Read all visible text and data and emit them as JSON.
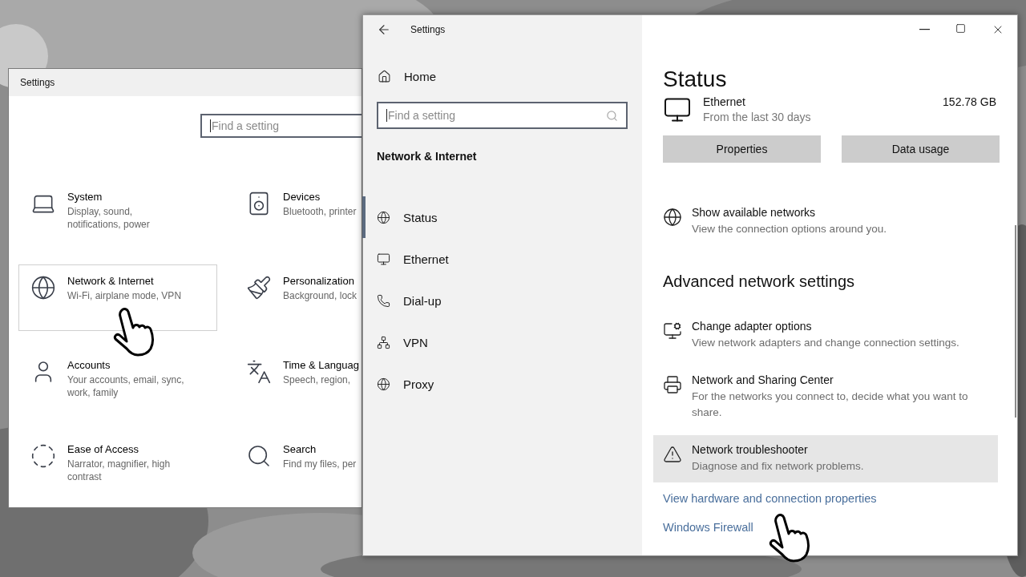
{
  "back_window": {
    "title": "Settings",
    "search": {
      "placeholder": "Find a setting"
    },
    "categories": [
      {
        "name": "System",
        "description": "Display, sound, notifications, power",
        "selected": false
      },
      {
        "name": "Devices",
        "description": "Bluetooth, printer",
        "selected": false
      },
      {
        "name": "Network & Internet",
        "description": "Wi-Fi, airplane mode, VPN",
        "selected": true
      },
      {
        "name": "Personalization",
        "description": "Background, lock",
        "selected": false
      },
      {
        "name": "Accounts",
        "description": "Your accounts, email, sync, work, family",
        "selected": false
      },
      {
        "name": "Time & Languag",
        "description": "Speech, region,",
        "selected": false
      },
      {
        "name": "Ease of Access",
        "description": "Narrator, magnifier, high contrast",
        "selected": false
      },
      {
        "name": "Search",
        "description": "Find my files, per",
        "selected": false
      }
    ]
  },
  "front_window": {
    "title": "Settings",
    "home": "Home",
    "search": {
      "placeholder": "Find a setting"
    },
    "section": "Network & Internet",
    "nav": [
      {
        "label": "Status",
        "selected": true
      },
      {
        "label": "Ethernet",
        "selected": false
      },
      {
        "label": "Dial-up",
        "selected": false
      },
      {
        "label": "VPN",
        "selected": false
      },
      {
        "label": "Proxy",
        "selected": false
      }
    ],
    "heading": "Status",
    "connection": {
      "name": "Ethernet",
      "detail": "From the last 30 days",
      "usage": "152.78 GB"
    },
    "buttons": [
      "Properties",
      "Data usage"
    ],
    "top_actions": [
      {
        "title": "Show available networks",
        "description": "View the connection options around you.",
        "highlighted": false
      }
    ],
    "advanced_heading": "Advanced network settings",
    "advanced_actions": [
      {
        "title": "Change adapter options",
        "description": "View network adapters and change connection settings.",
        "highlighted": false
      },
      {
        "title": "Network and Sharing Center",
        "description": "For the networks you connect to, decide what you want to share.",
        "highlighted": false
      },
      {
        "title": "Network troubleshooter",
        "description": "Diagnose and fix network problems.",
        "highlighted": true
      }
    ],
    "links": [
      "View hardware and connection properties",
      "Windows Firewall"
    ]
  }
}
